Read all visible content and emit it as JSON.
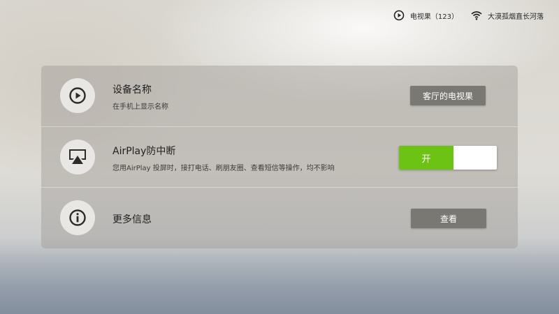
{
  "status_bar": {
    "device_label": "电视果（123）",
    "wifi_label": "大漠孤烟直长河落"
  },
  "rows": [
    {
      "title": "设备名称",
      "subtitle": "在手机上显示名称",
      "icon": "play-circle-icon",
      "button_label": "客厅的电视果"
    },
    {
      "title": "AirPlay防中断",
      "subtitle": "您用AirPlay 投屏时，接打电话、刷朋友圈、查看短信等操作，均不影响",
      "icon": "airplay-icon",
      "toggle_label": "开",
      "toggle_state": "on"
    },
    {
      "title": "更多信息",
      "icon": "info-icon",
      "button_label": "查看"
    }
  ],
  "colors": {
    "toggle_on": "#6dc314",
    "button_bg": "#7a7873",
    "icon_bg": "#e9e7e3"
  }
}
